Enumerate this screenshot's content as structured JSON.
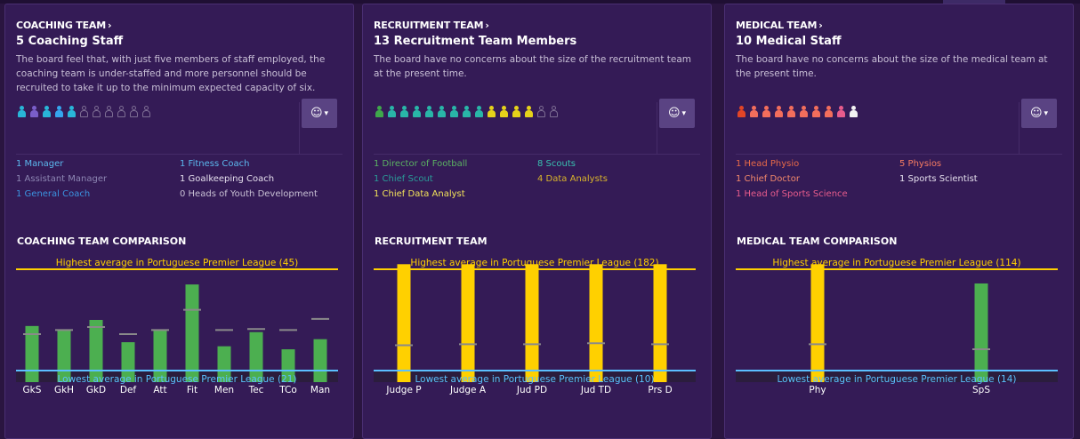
{
  "panels": [
    {
      "title": "COACHING TEAM",
      "subtitle": "5 Coaching Staff",
      "description": "The board feel that, with just five members of staff employed, the coaching team is under-staffed and more personnel should be recruited to take it up to the minimum expected capacity of six.",
      "icons": [
        "#29b6d8",
        "#7a5ec9",
        "#29b6d8",
        "#35a6ee",
        "#29b6d8",
        "empty",
        "empty",
        "empty",
        "empty",
        "empty",
        "empty"
      ],
      "staff_left": [
        {
          "text": "1 Manager",
          "color": "#5bb8ee"
        },
        {
          "text": "1 Assistant Manager",
          "color": "#8d86b3"
        },
        {
          "text": "1 General Coach",
          "color": "#3b93e0"
        }
      ],
      "staff_right": [
        {
          "text": "1 Fitness Coach",
          "color": "#5bb8ee"
        },
        {
          "text": "1 Goalkeeping Coach",
          "color": "#e6e0ee"
        },
        {
          "text": "0 Heads of Youth Development",
          "color": "#c8c0d4"
        }
      ],
      "chart_title": "COACHING TEAM COMPARISON",
      "chart": {
        "highest": "Highest average in Portuguese Premier League (45)",
        "lowest": "Lowest average in Portuguese Premier League (21)"
      }
    },
    {
      "title": "RECRUITMENT TEAM",
      "subtitle": "13 Recruitment Team Members",
      "description": "The board have no concerns about the size of the recruitment team at the present time.",
      "icons": [
        "#3fa84b",
        "#29b6a8",
        "#29b6a8",
        "#29b6a8",
        "#29b6a8",
        "#29b6a8",
        "#29b6a8",
        "#29b6a8",
        "#29b6a8",
        "#e6d21a",
        "#e6d21a",
        "#e6d21a",
        "#e6d21a",
        "empty",
        "empty"
      ],
      "staff_left": [
        {
          "text": "1 Director of Football",
          "color": "#5bb262"
        },
        {
          "text": "1 Chief Scout",
          "color": "#2a9c98"
        },
        {
          "text": "1 Chief Data Analyst",
          "color": "#f3e35a"
        }
      ],
      "staff_right": [
        {
          "text": "8 Scouts",
          "color": "#39c0b0"
        },
        {
          "text": "4 Data Analysts",
          "color": "#d9b42c"
        }
      ],
      "chart_title": "RECRUITMENT TEAM",
      "chart": {
        "highest": "Highest average in Portuguese Premier League (182)",
        "lowest": "Lowest average in Portuguese Premier League (10)"
      }
    },
    {
      "title": "MEDICAL TEAM",
      "subtitle": "10 Medical Staff",
      "description": "The board have no concerns about the size of the medical team at the present time.",
      "icons": [
        "#e24526",
        "#f36e5c",
        "#f36e5c",
        "#f36e5c",
        "#f36e5c",
        "#f36e5c",
        "#f36e5c",
        "#f36e5c",
        "#e85c8c",
        "#f2f2f2"
      ],
      "staff_left": [
        {
          "text": "1 Head Physio",
          "color": "#e86a48"
        },
        {
          "text": "1 Chief Doctor",
          "color": "#f2886c"
        },
        {
          "text": "1 Head of Sports Science",
          "color": "#e85c8c"
        }
      ],
      "staff_right": [
        {
          "text": "5 Physios",
          "color": "#f77c62"
        },
        {
          "text": "1 Sports Scientist",
          "color": "#e6e0ee"
        }
      ],
      "chart_title": "MEDICAL TEAM COMPARISON",
      "chart": {
        "highest": "Highest average in Portuguese Premier League (114)",
        "lowest": "Lowest average in Portuguese Premier League (14)"
      }
    }
  ],
  "chart_data": [
    {
      "type": "bar",
      "title": "COACHING TEAM COMPARISON",
      "categories": [
        "GkS",
        "GkH",
        "GkD",
        "Def",
        "Att",
        "Fit",
        "Men",
        "Tec",
        "TCo",
        "Man"
      ],
      "values": [
        0.44,
        0.4,
        0.5,
        0.28,
        0.4,
        0.85,
        0.24,
        0.38,
        0.21,
        0.31
      ],
      "averages": [
        0.36,
        0.4,
        0.43,
        0.36,
        0.4,
        0.6,
        0.4,
        0.41,
        0.4,
        0.51
      ],
      "series_color": "#4caf50",
      "ylim": [
        0,
        1
      ],
      "reference_lines": [
        "Highest average in Portuguese Premier League (45)",
        "Lowest average in Portuguese Premier League (21)"
      ]
    },
    {
      "type": "bar",
      "title": "RECRUITMENT TEAM",
      "categories": [
        "Judge P",
        "Judge A",
        "Jud PD",
        "Jud TD",
        "Prs D"
      ],
      "values": [
        1.05,
        1.05,
        1.05,
        1.05,
        1.05
      ],
      "averages": [
        0.25,
        0.26,
        0.26,
        0.27,
        0.26
      ],
      "series_color": "#ffd000",
      "ylim": [
        0,
        1
      ],
      "reference_lines": [
        "Highest average in Portuguese Premier League (182)",
        "Lowest average in Portuguese Premier League (10)"
      ]
    },
    {
      "type": "bar",
      "title": "MEDICAL TEAM COMPARISON",
      "categories": [
        "Phy",
        "SpS"
      ],
      "values": [
        1.05,
        0.86
      ],
      "averages": [
        0.26,
        0.21
      ],
      "series_colors": [
        "#ffd000",
        "#4caf50"
      ],
      "ylim": [
        0,
        1
      ],
      "reference_lines": [
        "Highest average in Portuguese Premier League (114)",
        "Lowest average in Portuguese Premier League (14)"
      ]
    }
  ]
}
